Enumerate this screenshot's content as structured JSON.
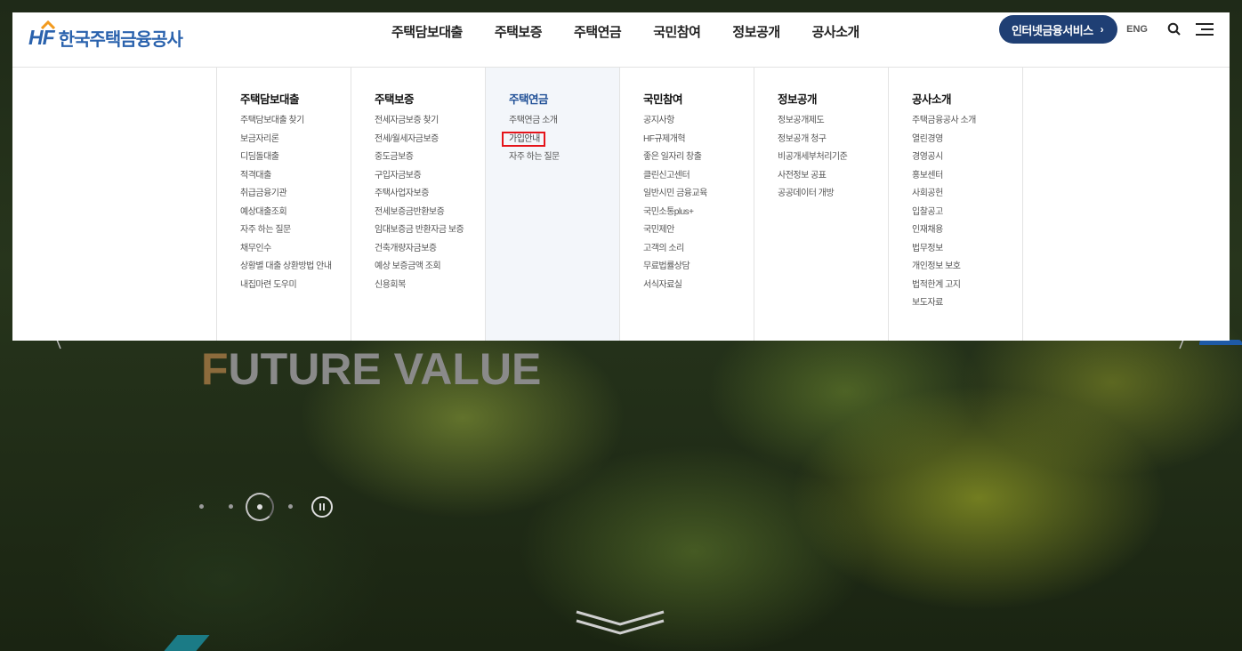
{
  "header": {
    "logo_mark": "HF",
    "logo_text": "한국주택금융공사",
    "nav": [
      "주택담보대출",
      "주택보증",
      "주택연금",
      "국민참여",
      "정보공개",
      "공사소개"
    ],
    "ibank_label": "인터넷금융서비스",
    "eng_label": "ENG"
  },
  "mega_menu": [
    {
      "title": "주택담보대출",
      "items": [
        "주택담보대출 찾기",
        "보금자리론",
        "디딤돌대출",
        "적격대출",
        "취급금융기관",
        "예상대출조회",
        "자주 하는 질문",
        "채무인수",
        "상황별 대출 상환방법 안내",
        "내집마련 도우미"
      ]
    },
    {
      "title": "주택보증",
      "items": [
        "전세자금보증 찾기",
        "전세/월세자금보증",
        "중도금보증",
        "구입자금보증",
        "주택사업자보증",
        "전세보증금반환보증",
        "임대보증금 반환자금 보증",
        "건축개량자금보증",
        "예상 보증금액 조회",
        "신용회복"
      ]
    },
    {
      "title": "주택연금",
      "items": [
        "주택연금 소개",
        "가입안내",
        "자주 하는 질문"
      ],
      "highlight_index": 1
    },
    {
      "title": "국민참여",
      "items": [
        "공지사항",
        "HF규제개혁",
        "좋은 일자리 창출",
        "클린신고센터",
        "일반시민 금융교육",
        "국민소통plus+",
        "국민제안",
        "고객의 소리",
        "무료법률상담",
        "서식자료실"
      ]
    },
    {
      "title": "정보공개",
      "items": [
        "정보공개제도",
        "정보공개 청구",
        "비공개세부처리기준",
        "사전정보 공표",
        "공공데이터 개방"
      ]
    },
    {
      "title": "공사소개",
      "items": [
        "주택금융공사 소개",
        "열린경영",
        "경영공시",
        "홍보센터",
        "사회공헌",
        "입찰공고",
        "인재채용",
        "법무정보",
        "개인정보 보호",
        "법적한계 고지",
        "보도자료"
      ]
    }
  ],
  "hero": {
    "title_first": "F",
    "title_rest": "UTURE VALUE"
  },
  "colors": {
    "brand_blue": "#2a62ad",
    "ibank_bg": "#1f3f74",
    "highlight_red": "#e5141a"
  }
}
